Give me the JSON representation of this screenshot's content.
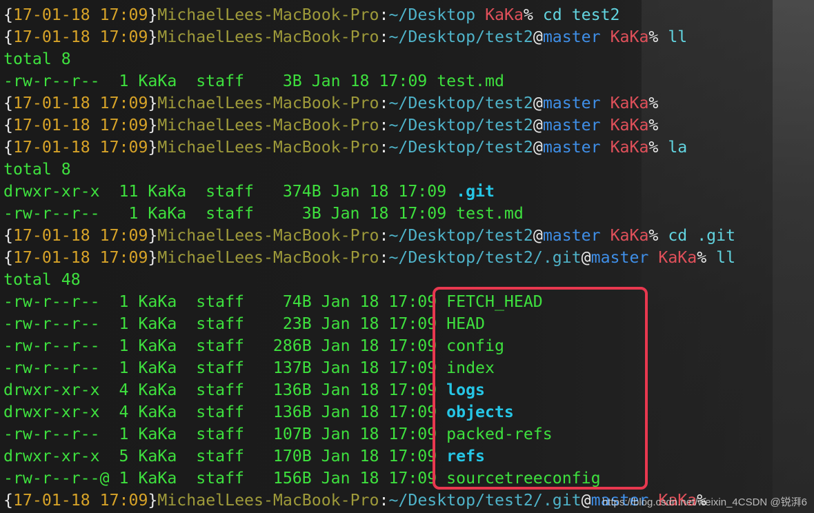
{
  "terminal": {
    "lines": [
      {
        "type": "prompt",
        "date": "17-01-18 17:09",
        "host": "MichaelLees-MacBook-Pro",
        "path": "~/Desktop",
        "branch": "",
        "user": "KaKa",
        "command": " cd test2"
      },
      {
        "type": "prompt",
        "date": "17-01-18 17:09",
        "host": "MichaelLees-MacBook-Pro",
        "path": "~/Desktop/test2",
        "branch": "master",
        "user": "KaKa",
        "command": " ll"
      },
      {
        "type": "output",
        "text": "total 8"
      },
      {
        "type": "entry",
        "text": "-rw-r--r--  1 KaKa  staff    3B Jan 18 17:09 ",
        "name": "test.md",
        "kind": "file"
      },
      {
        "type": "prompt",
        "date": "17-01-18 17:09",
        "host": "MichaelLees-MacBook-Pro",
        "path": "~/Desktop/test2",
        "branch": "master",
        "user": "KaKa",
        "command": ""
      },
      {
        "type": "prompt",
        "date": "17-01-18 17:09",
        "host": "MichaelLees-MacBook-Pro",
        "path": "~/Desktop/test2",
        "branch": "master",
        "user": "KaKa",
        "command": ""
      },
      {
        "type": "prompt",
        "date": "17-01-18 17:09",
        "host": "MichaelLees-MacBook-Pro",
        "path": "~/Desktop/test2",
        "branch": "master",
        "user": "KaKa",
        "command": " la"
      },
      {
        "type": "output",
        "text": "total 8"
      },
      {
        "type": "entry",
        "text": "drwxr-xr-x  11 KaKa  staff   374B Jan 18 17:09 ",
        "name": ".git",
        "kind": "dir"
      },
      {
        "type": "entry",
        "text": "-rw-r--r--   1 KaKa  staff     3B Jan 18 17:09 ",
        "name": "test.md",
        "kind": "file"
      },
      {
        "type": "prompt",
        "date": "17-01-18 17:09",
        "host": "MichaelLees-MacBook-Pro",
        "path": "~/Desktop/test2",
        "branch": "master",
        "user": "KaKa",
        "command": " cd .git"
      },
      {
        "type": "prompt",
        "date": "17-01-18 17:09",
        "host": "MichaelLees-MacBook-Pro",
        "path": "~/Desktop/test2/.git",
        "branch": "master",
        "user": "KaKa",
        "command": " ll"
      },
      {
        "type": "output",
        "text": "total 48"
      },
      {
        "type": "entry",
        "text": "-rw-r--r--  1 KaKa  staff    74B Jan 18 17:09 ",
        "name": "FETCH_HEAD",
        "kind": "file"
      },
      {
        "type": "entry",
        "text": "-rw-r--r--  1 KaKa  staff    23B Jan 18 17:09 ",
        "name": "HEAD",
        "kind": "file"
      },
      {
        "type": "entry",
        "text": "-rw-r--r--  1 KaKa  staff   286B Jan 18 17:09 ",
        "name": "config",
        "kind": "file"
      },
      {
        "type": "entry",
        "text": "-rw-r--r--  1 KaKa  staff   137B Jan 18 17:09 ",
        "name": "index",
        "kind": "file"
      },
      {
        "type": "entry",
        "text": "drwxr-xr-x  4 KaKa  staff   136B Jan 18 17:09 ",
        "name": "logs",
        "kind": "dir"
      },
      {
        "type": "entry",
        "text": "drwxr-xr-x  4 KaKa  staff   136B Jan 18 17:09 ",
        "name": "objects",
        "kind": "dir"
      },
      {
        "type": "entry",
        "text": "-rw-r--r--  1 KaKa  staff   107B Jan 18 17:09 ",
        "name": "packed-refs",
        "kind": "file"
      },
      {
        "type": "entry",
        "text": "drwxr-xr-x  5 KaKa  staff   170B Jan 18 17:09 ",
        "name": "refs",
        "kind": "dir"
      },
      {
        "type": "entry",
        "text": "-rw-r--r--@ 1 KaKa  staff   156B Jan 18 17:09 ",
        "name": "sourcetreeconfig",
        "kind": "file"
      },
      {
        "type": "prompt",
        "date": "17-01-18 17:09",
        "host": "MichaelLees-MacBook-Pro",
        "path": "~/Desktop/test2/.git",
        "branch": "master",
        "user": "KaKa",
        "command": ""
      }
    ]
  },
  "watermark": {
    "text": "https://blog.csdn.net/weixin_4CSDN @锐湃6"
  },
  "colors": {
    "annotation_box": "#e8384f",
    "background": "#1b1b1b"
  }
}
